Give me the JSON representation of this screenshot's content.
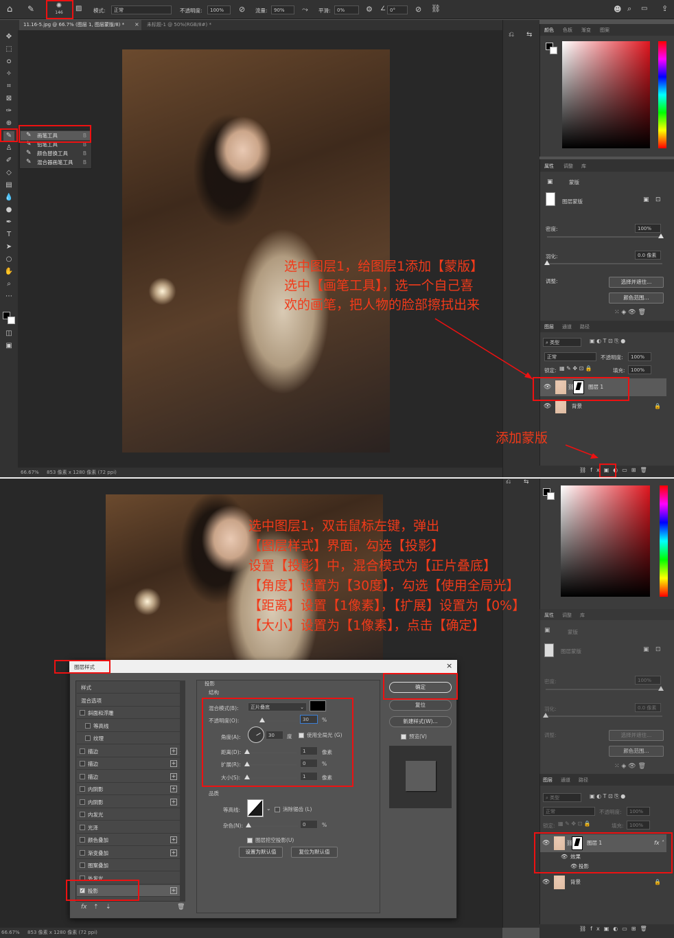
{
  "options_bar": {
    "brush_size": "146",
    "mode_label": "模式:",
    "mode_value": "正常",
    "opacity_label": "不透明度:",
    "opacity_value": "100%",
    "flow_label": "流量:",
    "flow_value": "90%",
    "smooth_label": "平滑:",
    "smooth_value": "0%",
    "angle_value": "0°"
  },
  "doc_tabs": [
    "11.16-5.jpg @ 66.7% (图层 1, 图层蒙版/8) *",
    "未标题-1 @ 50%(RGB/8#) *"
  ],
  "brush_menu": [
    {
      "label": "画笔工具",
      "key": "B"
    },
    {
      "label": "铅笔工具",
      "key": "B"
    },
    {
      "label": "颜色替换工具",
      "key": "B"
    },
    {
      "label": "混合器画笔工具",
      "key": "B"
    }
  ],
  "status_top": {
    "zoom": "66.67%",
    "info": "853 像素 x 1280 像素 (72 ppi)"
  },
  "status_bottom": {
    "zoom": "66.67%",
    "info": "853 像素 x 1280 像素 (72 ppi)"
  },
  "color_panel": {
    "tabs": [
      "颜色",
      "色板",
      "渐变",
      "图案"
    ]
  },
  "properties": {
    "tabs": [
      "属性",
      "调整",
      "库"
    ],
    "mask_label": "蒙版",
    "layer_mask": "图层蒙版",
    "density_label": "密度:",
    "density_value": "100%",
    "feather_label": "羽化:",
    "feather_value": "0.0 像素",
    "adjust_label": "调整:",
    "select_subject": "选择并遮住...",
    "color_range": "颜色范围..."
  },
  "layers": {
    "tabs": [
      "图层",
      "通道",
      "路径"
    ],
    "filter": "类型",
    "blend": "正常",
    "opacity_label": "不透明度:",
    "opacity": "100%",
    "lock_label": "锁定:",
    "fill_label": "填充:",
    "fill": "100%",
    "layer1": "图层 1",
    "background": "背景",
    "effects": "效果",
    "shadow": "投影"
  },
  "annotations": {
    "top": [
      "选中图层1，给图层1添加【蒙版】",
      "选中【画笔工具】，选一个自己喜",
      "欢的画笔，把人物的脸部擦拭出来"
    ],
    "add_mask": "添加蒙版",
    "bottom": [
      "选中图层1，双击鼠标左键，弹出",
      "【图层样式】界面，勾选【投影】",
      "设置【投影】中，混合模式为【正片叠底】",
      "【角度】设置为【30度】，勾选【使用全局光】",
      "【距离】设置【1像素】，【扩展】设置为【0%】",
      "【大小】设置为【1像素】，点击【确定】"
    ]
  },
  "dialog": {
    "title": "图层样式",
    "styles": [
      {
        "label": "样式",
        "box": false
      },
      {
        "label": "混合选项",
        "box": false
      },
      {
        "label": "斜面和浮雕",
        "box": true
      },
      {
        "label": "等高线",
        "box": true,
        "indent": true
      },
      {
        "label": "纹理",
        "box": true,
        "indent": true
      },
      {
        "label": "描边",
        "box": true,
        "plus": true
      },
      {
        "label": "描边",
        "box": true,
        "plus": true
      },
      {
        "label": "描边",
        "box": true,
        "plus": true
      },
      {
        "label": "内阴影",
        "box": true,
        "plus": true
      },
      {
        "label": "内阴影",
        "box": true,
        "plus": true
      },
      {
        "label": "内发光",
        "box": true
      },
      {
        "label": "光泽",
        "box": true
      },
      {
        "label": "颜色叠加",
        "box": true,
        "plus": true
      },
      {
        "label": "渐变叠加",
        "box": true,
        "plus": true
      },
      {
        "label": "图案叠加",
        "box": true
      },
      {
        "label": "外发光",
        "box": true
      },
      {
        "label": "投影",
        "box": true,
        "checked": true,
        "plus": true
      }
    ],
    "section_title": "投影",
    "structure": "结构",
    "blend_label": "混合模式(B):",
    "blend_value": "正片叠底",
    "opacity_label": "不透明度(O):",
    "opacity_value": "30",
    "pct": "%",
    "angle_label": "角度(A):",
    "angle_value": "30",
    "deg": "度",
    "global_light": "使用全局光 (G)",
    "distance_label": "距离(D):",
    "distance_value": "1",
    "px": "像素",
    "spread_label": "扩展(R):",
    "spread_value": "0",
    "size_label": "大小(S):",
    "size_value": "1",
    "quality": "品质",
    "contour_label": "等高线:",
    "antialias": "消除锯齿 (L)",
    "noise_label": "杂色(N):",
    "noise_value": "0",
    "knockout": "图层挖空投影(U)",
    "set_default": "设置为默认值",
    "reset_default": "复位为默认值",
    "ok": "确定",
    "reset": "复位",
    "new_style": "新建样式(W)...",
    "preview": "预览(V)"
  }
}
